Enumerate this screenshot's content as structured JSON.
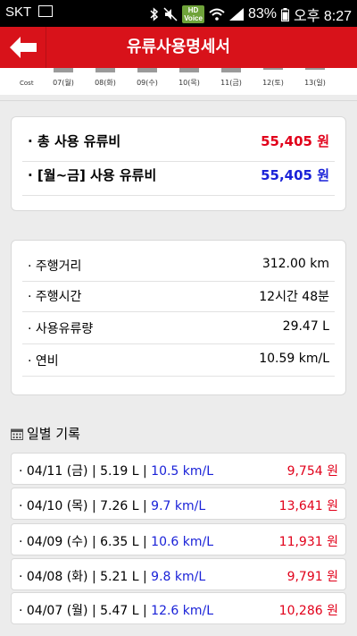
{
  "status_bar": {
    "carrier": "SKT",
    "hd_voice": "HD\nVoice",
    "battery": "83%",
    "time": "오후 8:27"
  },
  "header": {
    "title": "유류사용명세서"
  },
  "strip": {
    "cost_label": "Cost",
    "days": [
      "07(월)",
      "08(화)",
      "09(수)",
      "10(목)",
      "11(금)",
      "12(토)",
      "13(일)"
    ]
  },
  "summary": {
    "total_label": "· 총 사용 유류비",
    "total_value": "55,405 원",
    "weekday_label": "· [월~금] 사용 유류비",
    "weekday_value": "55,405 원"
  },
  "stats": [
    {
      "label": "· 주행거리",
      "value": "312.00 km"
    },
    {
      "label": "· 주행시간",
      "value": "12시간 48분"
    },
    {
      "label": "· 사용유류량",
      "value": "29.47 L"
    },
    {
      "label": "· 연비",
      "value": "10.59 km/L"
    }
  ],
  "daily_title": "일별 기록",
  "daily": [
    {
      "prefix": "· 04/11 (금) | 5.19 L | ",
      "eff": "10.5 km/L",
      "amount": "9,754 원"
    },
    {
      "prefix": "· 04/10 (목) | 7.26 L | ",
      "eff": "9.7 km/L",
      "amount": "13,641 원"
    },
    {
      "prefix": "· 04/09 (수) | 6.35 L | ",
      "eff": "10.6 km/L",
      "amount": "11,931 원"
    },
    {
      "prefix": "· 04/08 (화) | 5.21 L | ",
      "eff": "9.8 km/L",
      "amount": "9,791 원"
    },
    {
      "prefix": "· 04/07 (월) | 5.47 L | ",
      "eff": "12.6 km/L",
      "amount": "10,286 원"
    }
  ]
}
